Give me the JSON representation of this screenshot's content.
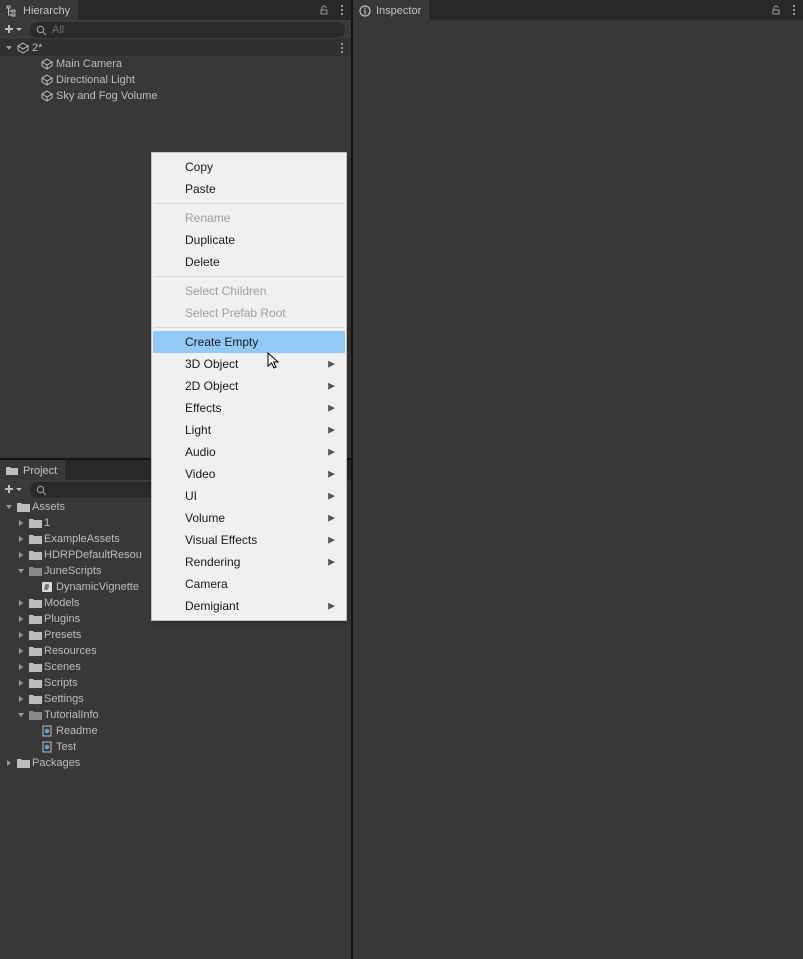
{
  "hierarchy": {
    "tab_label": "Hierarchy",
    "search_placeholder": "All",
    "scene_name": "2*",
    "objects": [
      "Main Camera",
      "Directional Light",
      "Sky and Fog Volume"
    ]
  },
  "project": {
    "tab_label": "Project",
    "root_assets": "Assets",
    "assets_items": [
      {
        "name": "1",
        "type": "folder",
        "expandable": true
      },
      {
        "name": "ExampleAssets",
        "type": "folder",
        "expandable": true
      },
      {
        "name": "HDRPDefaultResou",
        "type": "folder",
        "expandable": true
      },
      {
        "name": "JuneScripts",
        "type": "folder",
        "expanded": true,
        "children": [
          {
            "name": "DynamicVignette",
            "type": "script"
          }
        ]
      },
      {
        "name": "Models",
        "type": "folder",
        "expandable": true
      },
      {
        "name": "Plugins",
        "type": "folder",
        "expandable": true
      },
      {
        "name": "Presets",
        "type": "folder",
        "expandable": true
      },
      {
        "name": "Resources",
        "type": "folder",
        "expandable": true
      },
      {
        "name": "Scenes",
        "type": "folder",
        "expandable": true
      },
      {
        "name": "Scripts",
        "type": "folder",
        "expandable": true
      },
      {
        "name": "Settings",
        "type": "folder",
        "expandable": true
      },
      {
        "name": "TutorialInfo",
        "type": "folder",
        "expanded": true,
        "children": [
          {
            "name": "Readme",
            "type": "file"
          },
          {
            "name": "Test",
            "type": "file"
          }
        ]
      }
    ],
    "root_packages": "Packages"
  },
  "inspector": {
    "tab_label": "Inspector"
  },
  "context_menu": {
    "items": [
      {
        "label": "Copy",
        "disabled": false
      },
      {
        "label": "Paste",
        "disabled": false
      },
      {
        "sep": true
      },
      {
        "label": "Rename",
        "disabled": true
      },
      {
        "label": "Duplicate",
        "disabled": false
      },
      {
        "label": "Delete",
        "disabled": false
      },
      {
        "sep": true
      },
      {
        "label": "Select Children",
        "disabled": true
      },
      {
        "label": "Select Prefab Root",
        "disabled": true
      },
      {
        "sep": true
      },
      {
        "label": "Create Empty",
        "disabled": false,
        "highlighted": true
      },
      {
        "label": "3D Object",
        "disabled": false,
        "submenu": true
      },
      {
        "label": "2D Object",
        "disabled": false,
        "submenu": true
      },
      {
        "label": "Effects",
        "disabled": false,
        "submenu": true
      },
      {
        "label": "Light",
        "disabled": false,
        "submenu": true
      },
      {
        "label": "Audio",
        "disabled": false,
        "submenu": true
      },
      {
        "label": "Video",
        "disabled": false,
        "submenu": true
      },
      {
        "label": "UI",
        "disabled": false,
        "submenu": true
      },
      {
        "label": "Volume",
        "disabled": false,
        "submenu": true
      },
      {
        "label": "Visual Effects",
        "disabled": false,
        "submenu": true
      },
      {
        "label": "Rendering",
        "disabled": false,
        "submenu": true
      },
      {
        "label": "Camera",
        "disabled": false
      },
      {
        "label": "Demigiant",
        "disabled": false,
        "submenu": true
      }
    ]
  }
}
